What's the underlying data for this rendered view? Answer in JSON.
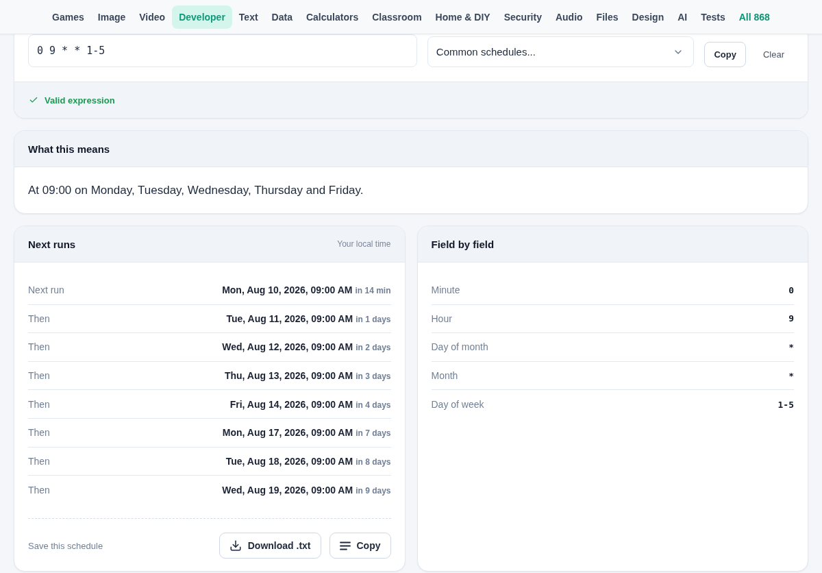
{
  "nav": {
    "items": [
      {
        "label": "Games",
        "kind": "category",
        "selected": false
      },
      {
        "label": "Image",
        "kind": "category",
        "selected": false
      },
      {
        "label": "Video",
        "kind": "category",
        "selected": false
      },
      {
        "label": "Developer",
        "kind": "category",
        "selected": true
      },
      {
        "label": "Text",
        "kind": "category",
        "selected": false
      },
      {
        "label": "Data",
        "kind": "category",
        "selected": false
      },
      {
        "label": "Calculators",
        "kind": "category",
        "selected": false
      },
      {
        "label": "Classroom",
        "kind": "category",
        "selected": false
      },
      {
        "label": "Home & DIY",
        "kind": "category",
        "selected": false
      },
      {
        "label": "Security",
        "kind": "category",
        "selected": false
      },
      {
        "label": "Audio",
        "kind": "category",
        "selected": false
      },
      {
        "label": "Files",
        "kind": "category",
        "selected": false
      },
      {
        "label": "Design",
        "kind": "category",
        "selected": false
      },
      {
        "label": "AI",
        "kind": "category",
        "selected": false
      },
      {
        "label": "Tests",
        "kind": "category",
        "selected": false
      },
      {
        "label": "All 868",
        "kind": "all",
        "selected": false
      }
    ]
  },
  "expression": {
    "value": "0 9 * * 1-5"
  },
  "preset": {
    "value": "Common schedules..."
  },
  "actions": [
    {
      "label": "Copy",
      "kind": "outline"
    },
    {
      "label": "Clear",
      "kind": "plain"
    }
  ],
  "status": {
    "valid": true,
    "text": "Valid expression"
  },
  "meaning": {
    "title": "What this means",
    "text": "At 09:00 on Monday, Tuesday, Wednesday, Thursday and Friday."
  },
  "next_runs": {
    "title": "Next runs",
    "note": "Your local time",
    "rows": [
      {
        "label": "Next run",
        "time": "Mon, Aug 10, 2026, 09:00 AM",
        "relative": "in 14 min"
      },
      {
        "label": "Then",
        "time": "Tue, Aug 11, 2026, 09:00 AM",
        "relative": "in 1 days"
      },
      {
        "label": "Then",
        "time": "Wed, Aug 12, 2026, 09:00 AM",
        "relative": "in 2 days"
      },
      {
        "label": "Then",
        "time": "Thu, Aug 13, 2026, 09:00 AM",
        "relative": "in 3 days"
      },
      {
        "label": "Then",
        "time": "Fri, Aug 14, 2026, 09:00 AM",
        "relative": "in 4 days"
      },
      {
        "label": "Then",
        "time": "Mon, Aug 17, 2026, 09:00 AM",
        "relative": "in 7 days"
      },
      {
        "label": "Then",
        "time": "Tue, Aug 18, 2026, 09:00 AM",
        "relative": "in 8 days"
      },
      {
        "label": "Then",
        "time": "Wed, Aug 19, 2026, 09:00 AM",
        "relative": "in 9 days"
      }
    ],
    "footer_label": "Save this schedule",
    "buttons": [
      {
        "label": "Download .txt",
        "kind": "download"
      },
      {
        "label": "Copy",
        "kind": "copy"
      }
    ]
  },
  "fields": {
    "title": "Field by field",
    "rows": [
      {
        "name": "Minute",
        "value": "0"
      },
      {
        "name": "Hour",
        "value": "9"
      },
      {
        "name": "Day of month",
        "value": "*"
      },
      {
        "name": "Month",
        "value": "*"
      },
      {
        "name": "Day of week",
        "value": "1-5"
      }
    ]
  }
}
